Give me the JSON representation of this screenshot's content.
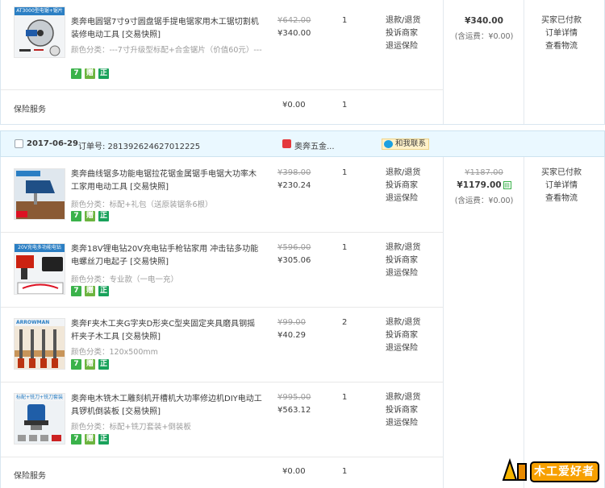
{
  "order1": {
    "item": {
      "thumb_caption": "AT3000型电锯+锯片",
      "title": "奥奔电圆锯7寸9寸圆盘锯手提电锯家用木工锯切割机装修电动工具 [交易快照]",
      "sku": "颜色分类：---7寸升级型标配+合金锯片（价值60元）---",
      "price_old": "¥642.00",
      "price_now": "¥340.00",
      "qty": "1",
      "services": [
        "退款/退货",
        "投诉商家",
        "退运保险"
      ],
      "badges": [
        "7",
        "赠",
        "正"
      ]
    },
    "insurance": {
      "label": "保险服务",
      "price": "¥0.00",
      "qty": "1"
    },
    "total": {
      "amount": "¥340.00",
      "shipping": "(含运费：¥0.00)"
    },
    "status": [
      "买家已付款",
      "订单详情",
      "查看物流"
    ]
  },
  "order2": {
    "header": {
      "date": "2017-06-29",
      "order_no_label": "订单号: 281392624627012225",
      "shop": "奥奔五金...",
      "contact": "和我联系"
    },
    "items": [
      {
        "title": "奥奔曲线锯多功能电锯拉花锯金属锯手电锯大功率木工家用电动工具 [交易快照]",
        "sku": "颜色分类：标配+礼包（送原装锯条6根）",
        "price_old": "¥398.00",
        "price_now": "¥230.24",
        "qty": "1",
        "services": [
          "退款/退货",
          "投诉商家",
          "退运保险"
        ],
        "badges": [
          "7",
          "赠",
          "正"
        ]
      },
      {
        "thumb_caption": "20V充电多功能电钻",
        "title": "奥奔18V锂电钻20V充电钻手枪钻家用 冲击钻多功能电螺丝刀电起子 [交易快照]",
        "sku": "颜色分类：专业款（一电一充）",
        "price_old": "¥596.00",
        "price_now": "¥305.06",
        "qty": "1",
        "services": [
          "退款/退货",
          "投诉商家",
          "退运保险"
        ],
        "badges": [
          "7",
          "赠",
          "正"
        ]
      },
      {
        "thumb_caption": "ARROWMAN",
        "title": "奥奔F夹木工夹G字夹D形夹C型夹固定夹具磨具钢摇杆夹子木工具 [交易快照]",
        "sku": "颜色分类：120x500mm",
        "price_old": "¥99.00",
        "price_now": "¥40.29",
        "qty": "2",
        "services": [
          "退款/退货",
          "投诉商家",
          "退运保险"
        ],
        "badges": [
          "7",
          "赠",
          "正"
        ]
      },
      {
        "thumb_caption": "标配+铣刀+铣刀套装",
        "title": "奥奔电木铣木工雕刻机开槽机大功率修边机DIY电动工具锣机倒装板 [交易快照]",
        "sku": "颜色分类：标配+铣刀套装+倒装板",
        "price_old": "¥995.00",
        "price_now": "¥563.12",
        "qty": "1",
        "services": [
          "退款/退货",
          "投诉商家",
          "退运保险"
        ],
        "badges": [
          "7",
          "赠",
          "正"
        ]
      }
    ],
    "insurance": {
      "label": "保险服务",
      "price": "¥0.00",
      "qty": "1"
    },
    "total": {
      "amount_old": "¥1187.00",
      "amount": "¥1179.00",
      "shipping": "(含运费：¥0.00)"
    },
    "status": [
      "买家已付款",
      "订单详情",
      "查看物流"
    ]
  },
  "watermark": {
    "text": "木工爱好者"
  },
  "colors": {
    "accent_blue": "#1ba0e1",
    "header_bg": "#eaf8ff",
    "badge_green": "#3ab24a"
  }
}
